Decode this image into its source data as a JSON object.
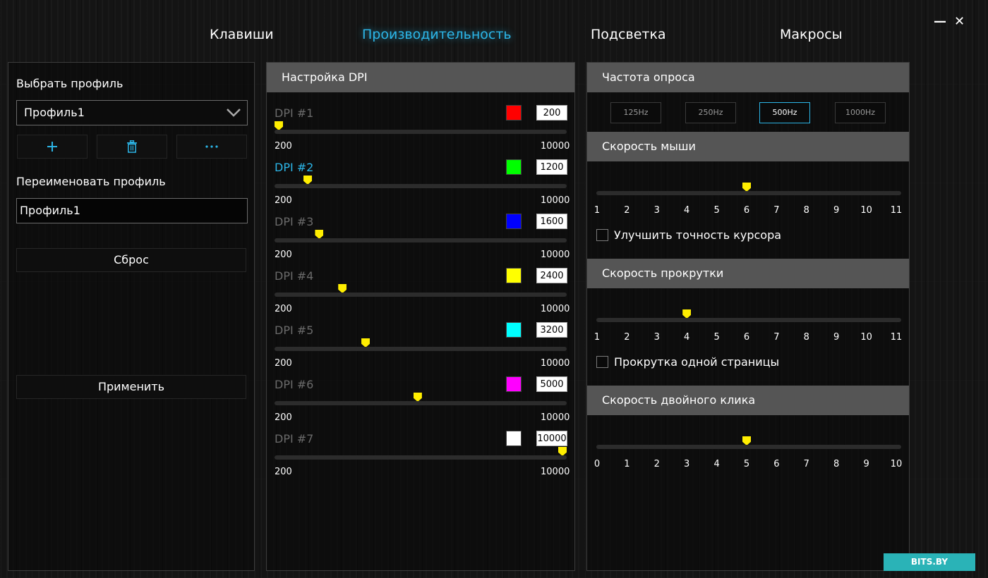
{
  "window": {
    "minimize": "—",
    "close": "✕"
  },
  "tabs": [
    {
      "label": "Клавиши",
      "active": false
    },
    {
      "label": "Производительность",
      "active": true
    },
    {
      "label": "Подсветка",
      "active": false
    },
    {
      "label": "Макросы",
      "active": false
    }
  ],
  "profile": {
    "select_label": "Выбрать профиль",
    "selected": "Профиль1",
    "add_icon": "plus-icon",
    "delete_icon": "trash-icon",
    "more_icon": "more-icon",
    "rename_label": "Переименовать профиль",
    "rename_value": "Профиль1",
    "reset_label": "Сброс",
    "apply_label": "Применить"
  },
  "dpi": {
    "title": "Настройка DPI",
    "min_label": "200",
    "max_label": "10000",
    "min": 200,
    "max": 10000,
    "items": [
      {
        "label": "DPI #1",
        "color": "#ff0000",
        "value": "200",
        "active": false
      },
      {
        "label": "DPI #2",
        "color": "#00ff00",
        "value": "1200",
        "active": true
      },
      {
        "label": "DPI #3",
        "color": "#0000ff",
        "value": "1600",
        "active": false
      },
      {
        "label": "DPI #4",
        "color": "#ffff00",
        "value": "2400",
        "active": false
      },
      {
        "label": "DPI #5",
        "color": "#00ffff",
        "value": "3200",
        "active": false
      },
      {
        "label": "DPI #6",
        "color": "#ff00ff",
        "value": "5000",
        "active": false
      },
      {
        "label": "DPI #7",
        "color": "#ffffff",
        "value": "10000",
        "active": false
      }
    ]
  },
  "polling": {
    "title": "Частота опроса",
    "rates": [
      {
        "label": "125Hz",
        "active": false
      },
      {
        "label": "250Hz",
        "active": false
      },
      {
        "label": "500Hz",
        "active": true
      },
      {
        "label": "1000Hz",
        "active": false
      }
    ]
  },
  "mouse_speed": {
    "title": "Скорость мыши",
    "ticks": [
      "1",
      "2",
      "3",
      "4",
      "5",
      "6",
      "7",
      "8",
      "9",
      "10",
      "11"
    ],
    "value": 6,
    "min": 1,
    "max": 11,
    "checkbox_label": "Улучшить точность курсора",
    "checked": false
  },
  "scroll_speed": {
    "title": "Скорость прокрутки",
    "ticks": [
      "1",
      "2",
      "3",
      "4",
      "5",
      "6",
      "7",
      "8",
      "9",
      "10",
      "11"
    ],
    "value": 4,
    "min": 1,
    "max": 11,
    "checkbox_label": "Прокрутка одной страницы",
    "checked": false
  },
  "double_click": {
    "title": "Скорость двойного клика",
    "ticks": [
      "0",
      "1",
      "2",
      "3",
      "4",
      "5",
      "6",
      "7",
      "8",
      "9",
      "10"
    ],
    "value": 5,
    "min": 0,
    "max": 10
  },
  "watermark": "BITS.BY",
  "colors": {
    "accent": "#2cb6e8",
    "thumb": "#ffee00",
    "header": "#555555"
  }
}
